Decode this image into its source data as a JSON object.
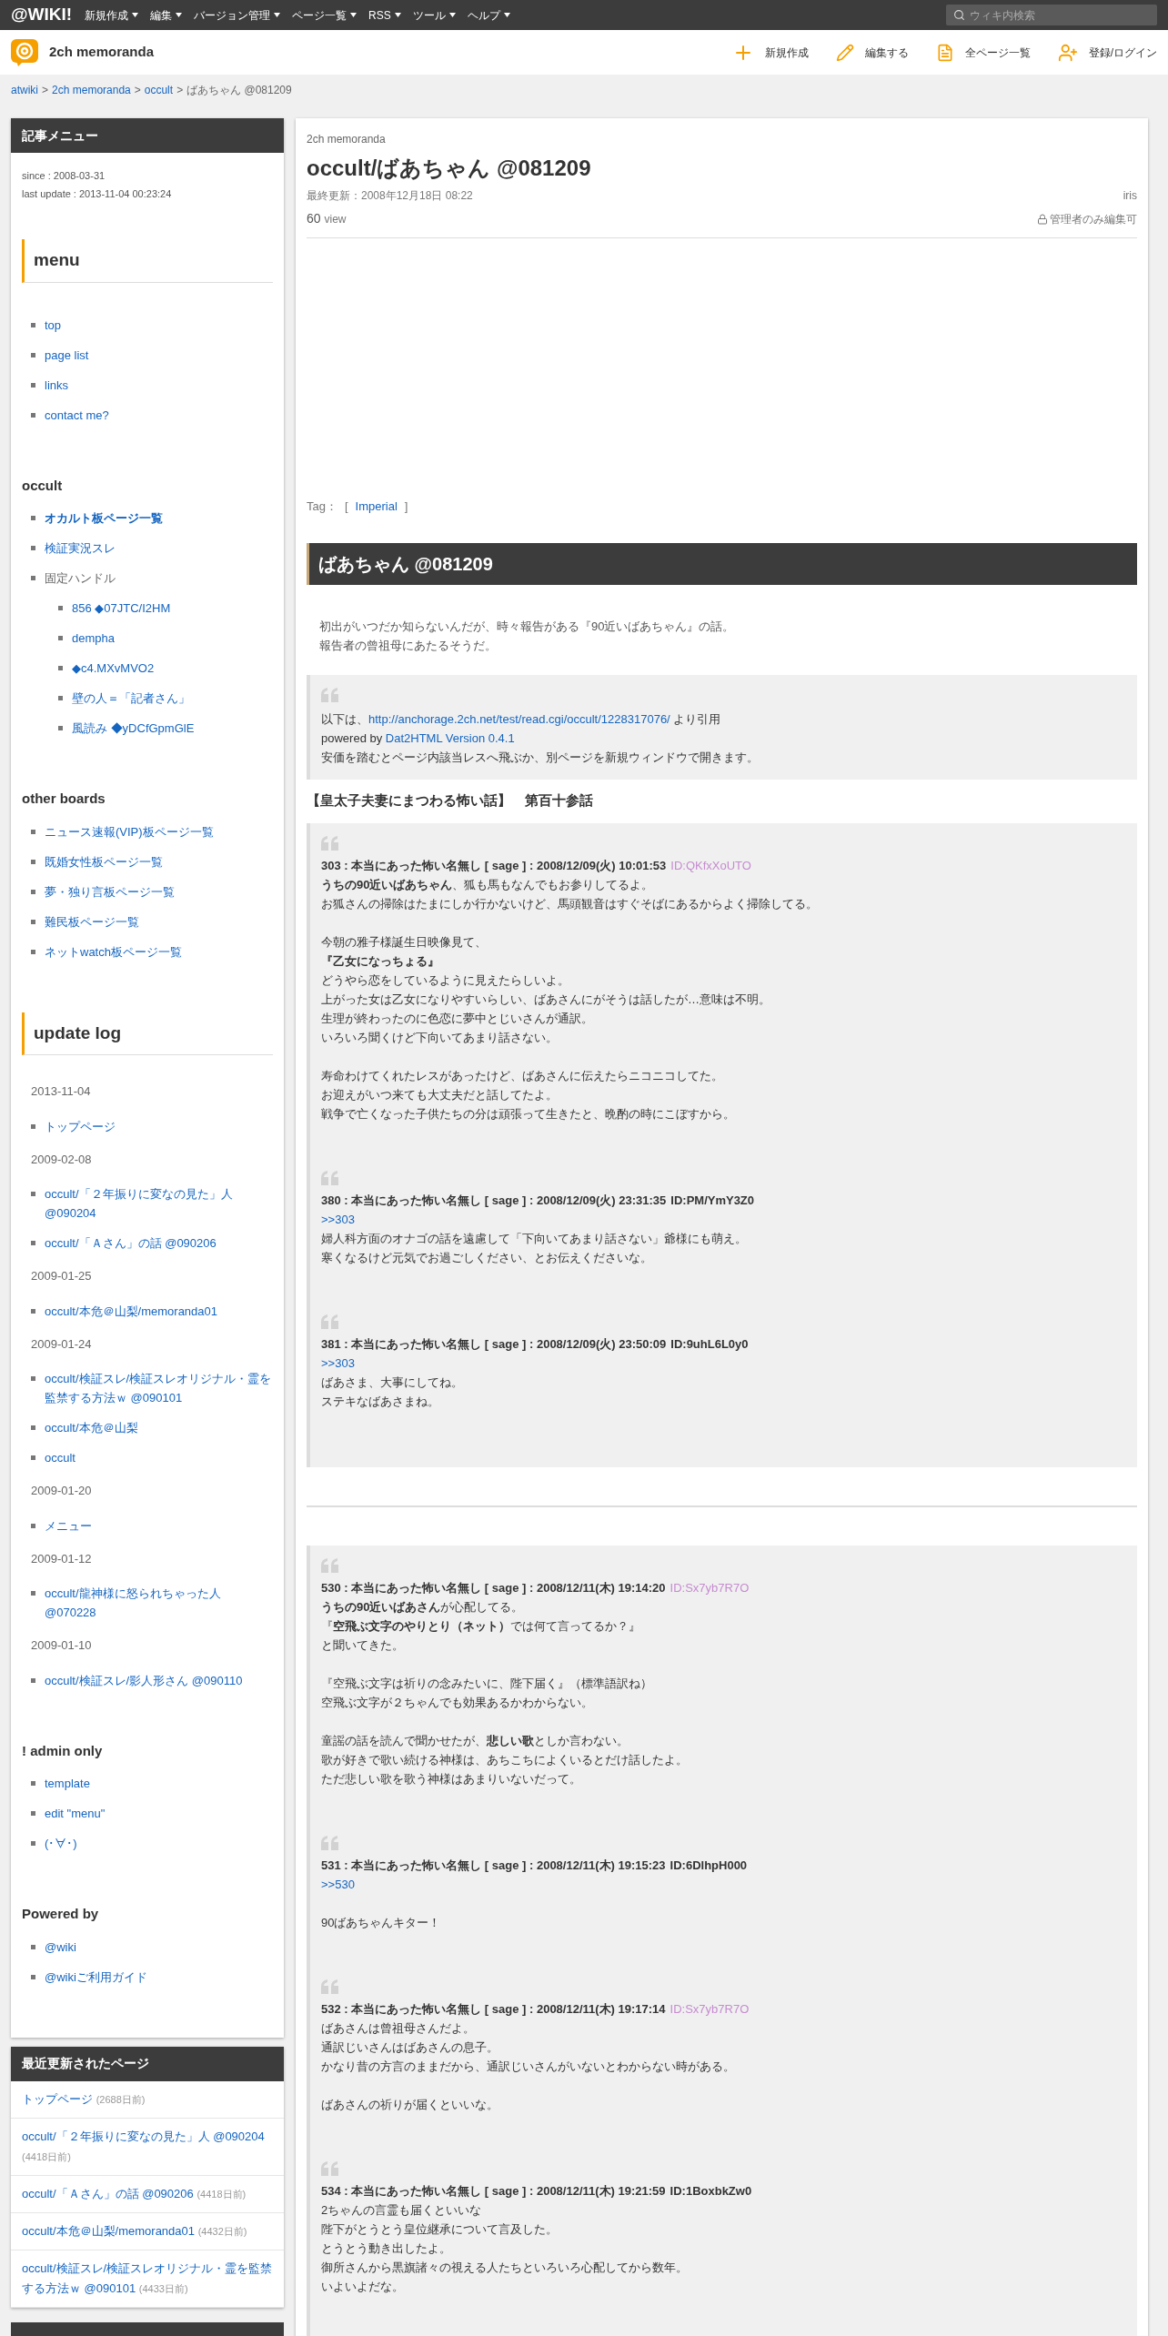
{
  "top_nav": {
    "logo": "@WIKI!",
    "menu": [
      {
        "label": "新規作成"
      },
      {
        "label": "編集"
      },
      {
        "label": "バージョン管理"
      },
      {
        "label": "ページ一覧"
      },
      {
        "label": "RSS"
      },
      {
        "label": "ツール"
      },
      {
        "label": "ヘルプ"
      }
    ],
    "search": {
      "placeholder": "ウィキ内検索"
    }
  },
  "site_header": {
    "title": "2ch memoranda",
    "actions": [
      {
        "kind": "plus",
        "label": "新規作成"
      },
      {
        "kind": "edit",
        "label": "編集する"
      },
      {
        "kind": "pages",
        "label": "全ページ一覧"
      },
      {
        "kind": "users",
        "label": "登録/ログイン"
      }
    ]
  },
  "breadcrumb": [
    {
      "kind": "link",
      "text": "atwiki"
    },
    {
      "kind": "separator",
      "text": ">"
    },
    {
      "kind": "link",
      "text": "2ch memoranda"
    },
    {
      "kind": "separator",
      "text": ">"
    },
    {
      "kind": "link",
      "text": "occult"
    },
    {
      "kind": "separator",
      "text": ">"
    },
    {
      "kind": "current",
      "text": "ばあちゃん @081209"
    }
  ],
  "sidebar": {
    "article_menu": {
      "title": "記事メニュー",
      "since": "since : 2008-03-31",
      "last_update": "last update : 2013-11-04 00:23:24",
      "sections": [
        {
          "kind": "boxed",
          "heading": "menu",
          "blocks": [
            {
              "kind": "list",
              "items": [
                {
                  "label": "top"
                },
                {
                  "label": "page list"
                },
                {
                  "label": "links"
                },
                {
                  "label": "contact me?"
                }
              ]
            }
          ]
        },
        {
          "kind": "plain",
          "heading": "occult",
          "blocks": [
            {
              "kind": "list",
              "items": [
                {
                  "label": "オカルト板ページ一覧",
                  "link": true,
                  "bold": true
                },
                {
                  "label": "検証実況スレ",
                  "link": true,
                  "bold": false
                },
                {
                  "label": "固定ハンドル",
                  "link": false,
                  "bold": false,
                  "children": [
                    {
                      "label": "856 ◆07JTC/I2HM"
                    },
                    {
                      "label": "dempha"
                    },
                    {
                      "label": "◆c4.MXvMVO2"
                    },
                    {
                      "label": "壁の人＝「記者さん」"
                    },
                    {
                      "label": "風読み ◆yDCfGpmGlE"
                    }
                  ]
                }
              ]
            }
          ]
        },
        {
          "kind": "plain",
          "heading": "other boards",
          "blocks": [
            {
              "kind": "list",
              "items": [
                {
                  "label": "ニュース速報(VIP)板ページ一覧"
                },
                {
                  "label": "既婚女性板ページ一覧"
                },
                {
                  "label": "夢・独り言板ページ一覧"
                },
                {
                  "label": "難民板ページ一覧"
                },
                {
                  "label": "ネットwatch板ページ一覧"
                }
              ]
            }
          ]
        },
        {
          "kind": "boxed",
          "heading": "update log",
          "blocks": [
            {
              "kind": "date",
              "text": "2013-11-04"
            },
            {
              "kind": "list",
              "items": [
                {
                  "label": "トップページ"
                }
              ]
            },
            {
              "kind": "date",
              "text": "2009-02-08"
            },
            {
              "kind": "list",
              "items": [
                {
                  "label": "occult/「２年振りに変なの見た」人 @090204"
                },
                {
                  "label": "occult/「Ａさん」の話 @090206"
                }
              ]
            },
            {
              "kind": "date",
              "text": "2009-01-25"
            },
            {
              "kind": "list",
              "items": [
                {
                  "label": "occult/本危＠山梨/memoranda01"
                }
              ]
            },
            {
              "kind": "date",
              "text": "2009-01-24"
            },
            {
              "kind": "list",
              "items": [
                {
                  "label": "occult/検証スレ/検証スレオリジナル・霊を監禁する方法ｗ @090101"
                },
                {
                  "label": "occult/本危＠山梨"
                },
                {
                  "label": "occult"
                }
              ]
            },
            {
              "kind": "date",
              "text": "2009-01-20"
            },
            {
              "kind": "list",
              "items": [
                {
                  "label": "メニュー"
                }
              ]
            },
            {
              "kind": "date",
              "text": "2009-01-12"
            },
            {
              "kind": "list",
              "items": [
                {
                  "label": "occult/龍神様に怒られちゃった人 @070228"
                }
              ]
            },
            {
              "kind": "date",
              "text": "2009-01-10"
            },
            {
              "kind": "list",
              "items": [
                {
                  "label": "occult/検証スレ/影人形さん @090110"
                }
              ]
            }
          ]
        },
        {
          "kind": "plain",
          "heading": "! admin only",
          "blocks": [
            {
              "kind": "list",
              "items": [
                {
                  "label": "template"
                },
                {
                  "label": "edit \"menu\""
                },
                {
                  "label": "(･∀･)"
                }
              ]
            }
          ]
        },
        {
          "kind": "plain",
          "heading": "Powered by",
          "blocks": [
            {
              "kind": "list",
              "items": [
                {
                  "label": "@wiki"
                },
                {
                  "label": "@wikiご利用ガイド"
                }
              ]
            }
          ]
        }
      ]
    },
    "recent": {
      "title": "最近更新されたページ",
      "items": [
        {
          "label": "トップページ",
          "age": "(2688日前)"
        },
        {
          "label": "occult/「２年振りに変なの見た」人 @090204",
          "age": "(4418日前)"
        },
        {
          "label": "occult/「Ａさん」の話 @090206",
          "age": "(4418日前)"
        },
        {
          "label": "occult/本危＠山梨/memoranda01",
          "age": "(4432日前)"
        },
        {
          "label": "occult/検証スレ/検証スレオリジナル・霊を監禁する方法ｗ @090101",
          "age": "(4433日前)"
        }
      ]
    }
  },
  "article": {
    "site": "2ch memoranda",
    "title": "occult/ばあちゃん @081209",
    "updated": "最終更新：2008年12月18日 08:22",
    "author": "iris",
    "views": "60",
    "views_unit": "view",
    "lock": "管理者のみ編集可",
    "tags": {
      "label": "Tag：",
      "open": "[",
      "close": "]",
      "items": [
        "Imperial"
      ]
    },
    "heading": "ばあちゃん @081209",
    "intro": [
      "初出がいつだか知らないんだが、時々報告がある『90近いばあちゃん』の話。",
      "報告者の曾祖母にあたるそうだ。"
    ],
    "source_quote": [
      [
        {
          "kind": "text",
          "text": "以下は、"
        },
        {
          "kind": "link",
          "text": "http://anchorage.2ch.net/test/read.cgi/occult/1228317076/"
        },
        {
          "kind": "text",
          "text": " より引用"
        }
      ],
      [
        {
          "kind": "text",
          "text": "powered by "
        },
        {
          "kind": "link",
          "text": "Dat2HTML Version 0.4.1"
        }
      ],
      [
        {
          "kind": "text",
          "text": "安価を踏むとページ内該当レスへ飛ぶか、別ページを新規ウィンドウで開きます。"
        }
      ]
    ],
    "section_title": "【皇太子夫妻にまつわる怖い話】　第百十参話",
    "thread_blocks": [
      {
        "posts": [
          {
            "header": "303 : 本当にあった怖い名無し [ sage ] : 2008/12/09(火) 10:01:53",
            "id": "ID:QKfxXoUTO",
            "id_highlighted": true,
            "paragraphs": [
              [
                {
                  "kind": "text",
                  "text": "**うちの90近いばあちゃん**、狐も馬もなんでもお参りしてるよ。"
                },
                {
                  "kind": "text",
                  "text": "お狐さんの掃除はたまにしか行かないけど、馬頭観音はすぐそばにあるからよく掃除してる。"
                }
              ],
              [
                {
                  "kind": "text",
                  "text": "今朝の雅子様誕生日映像見て、"
                },
                {
                  "kind": "text",
                  "text": "**『乙女になっちょる』**"
                },
                {
                  "kind": "text",
                  "text": "どうやら恋をしているように見えたらしいよ。"
                },
                {
                  "kind": "text",
                  "text": "上がった女は乙女になりやすいらしい、ばあさんにがそうは話したが…意味は不明。"
                },
                {
                  "kind": "text",
                  "text": "生理が終わったのに色恋に夢中とじいさんが通訳。"
                },
                {
                  "kind": "text",
                  "text": "いろいろ聞くけど下向いてあまり話さない。"
                }
              ],
              [
                {
                  "kind": "text",
                  "text": "寿命わけてくれたレスがあったけど、ばあさんに伝えたらニコニコしてた。"
                },
                {
                  "kind": "text",
                  "text": "お迎えがいつ来ても大丈夫だと話してたよ。"
                },
                {
                  "kind": "text",
                  "text": "戦争で亡くなった子供たちの分は頑張って生きたと、晩酌の時にこぼすから。"
                }
              ]
            ]
          },
          {
            "header": "380 : 本当にあった怖い名無し [ sage ] : 2008/12/09(火) 23:31:35",
            "id": "ID:PM/YmY3Z0",
            "id_highlighted": false,
            "paragraphs": [
              [
                {
                  "kind": "anchor",
                  "text": ">>303"
                },
                {
                  "kind": "text",
                  "text": "婦人科方面のオナゴの話を遠慮して「下向いてあまり話さない」爺様にも萌え。"
                },
                {
                  "kind": "text",
                  "text": "寒くなるけど元気でお過ごしください、とお伝えくださいな。"
                }
              ]
            ]
          },
          {
            "header": "381 : 本当にあった怖い名無し [ sage ] : 2008/12/09(火) 23:50:09",
            "id": "ID:9uhL6L0y0",
            "id_highlighted": false,
            "paragraphs": [
              [
                {
                  "kind": "anchor",
                  "text": ">>303"
                },
                {
                  "kind": "text",
                  "text": "ばあさま、大事にしてね。"
                },
                {
                  "kind": "text",
                  "text": "ステキなばあさまね。"
                }
              ]
            ]
          }
        ]
      },
      {
        "posts": [
          {
            "header": "530 : 本当にあった怖い名無し [ sage ] : 2008/12/11(木) 19:14:20",
            "id": "ID:Sx7yb7R7O",
            "id_highlighted": true,
            "paragraphs": [
              [
                {
                  "kind": "text",
                  "text": "**うちの90近いばあさん**が心配してる。"
                },
                {
                  "kind": "text",
                  "text": "『**空飛ぶ文字のやりとり（ネット）**では何て言ってるか？』"
                },
                {
                  "kind": "text",
                  "text": "と聞いてきた。"
                }
              ],
              [
                {
                  "kind": "text",
                  "text": "『空飛ぶ文字は祈りの念みたいに、陛下届く』（標準語訳ね）"
                },
                {
                  "kind": "text",
                  "text": "空飛ぶ文字が２ちゃんでも効果あるかわからない。"
                }
              ],
              [
                {
                  "kind": "text",
                  "text": "童謡の話を読んで聞かせたが、**悲しい歌**としか言わない。"
                },
                {
                  "kind": "text",
                  "text": "歌が好きで歌い続ける神様は、あちこちによくいるとだけ話したよ。"
                },
                {
                  "kind": "text",
                  "text": "ただ悲しい歌を歌う神様はあまりいないだって。"
                }
              ]
            ]
          },
          {
            "header": "531 : 本当にあった怖い名無し [ sage ] : 2008/12/11(木) 19:15:23",
            "id": "ID:6DlhpH000",
            "id_highlighted": false,
            "paragraphs": [
              [
                {
                  "kind": "anchor",
                  "text": ">>530"
                }
              ],
              [
                {
                  "kind": "text",
                  "text": "90ばあちゃんキター！"
                }
              ]
            ]
          },
          {
            "header": "532 : 本当にあった怖い名無し [ sage ] : 2008/12/11(木) 19:17:14",
            "id": "ID:Sx7yb7R7O",
            "id_highlighted": true,
            "paragraphs": [
              [
                {
                  "kind": "text",
                  "text": "ばあさんは曾祖母さんだよ。"
                },
                {
                  "kind": "text",
                  "text": "通訳じいさんはばあさんの息子。"
                },
                {
                  "kind": "text",
                  "text": "かなり昔の方言のままだから、通訳じいさんがいないとわからない時がある。"
                }
              ],
              [
                {
                  "kind": "text",
                  "text": "ばあさんの祈りが届くといいな。"
                }
              ]
            ]
          },
          {
            "header": "534 : 本当にあった怖い名無し [ sage ] : 2008/12/11(木) 19:21:59",
            "id": "ID:1BoxbkZw0",
            "id_highlighted": false,
            "paragraphs": [
              [
                {
                  "kind": "text",
                  "text": "2ちゃんの言霊も届くといいな"
                },
                {
                  "kind": "text",
                  "text": "陛下がとうとう皇位継承について言及した。"
                },
                {
                  "kind": "text",
                  "text": "とうとう動き出したよ。"
                },
                {
                  "kind": "text",
                  "text": "御所さんから黒旗諸々の視える人たちといろいろ心配してから数年。"
                },
                {
                  "kind": "text",
                  "text": "いよいよだな。"
                }
              ]
            ]
          }
        ]
      }
    ]
  }
}
